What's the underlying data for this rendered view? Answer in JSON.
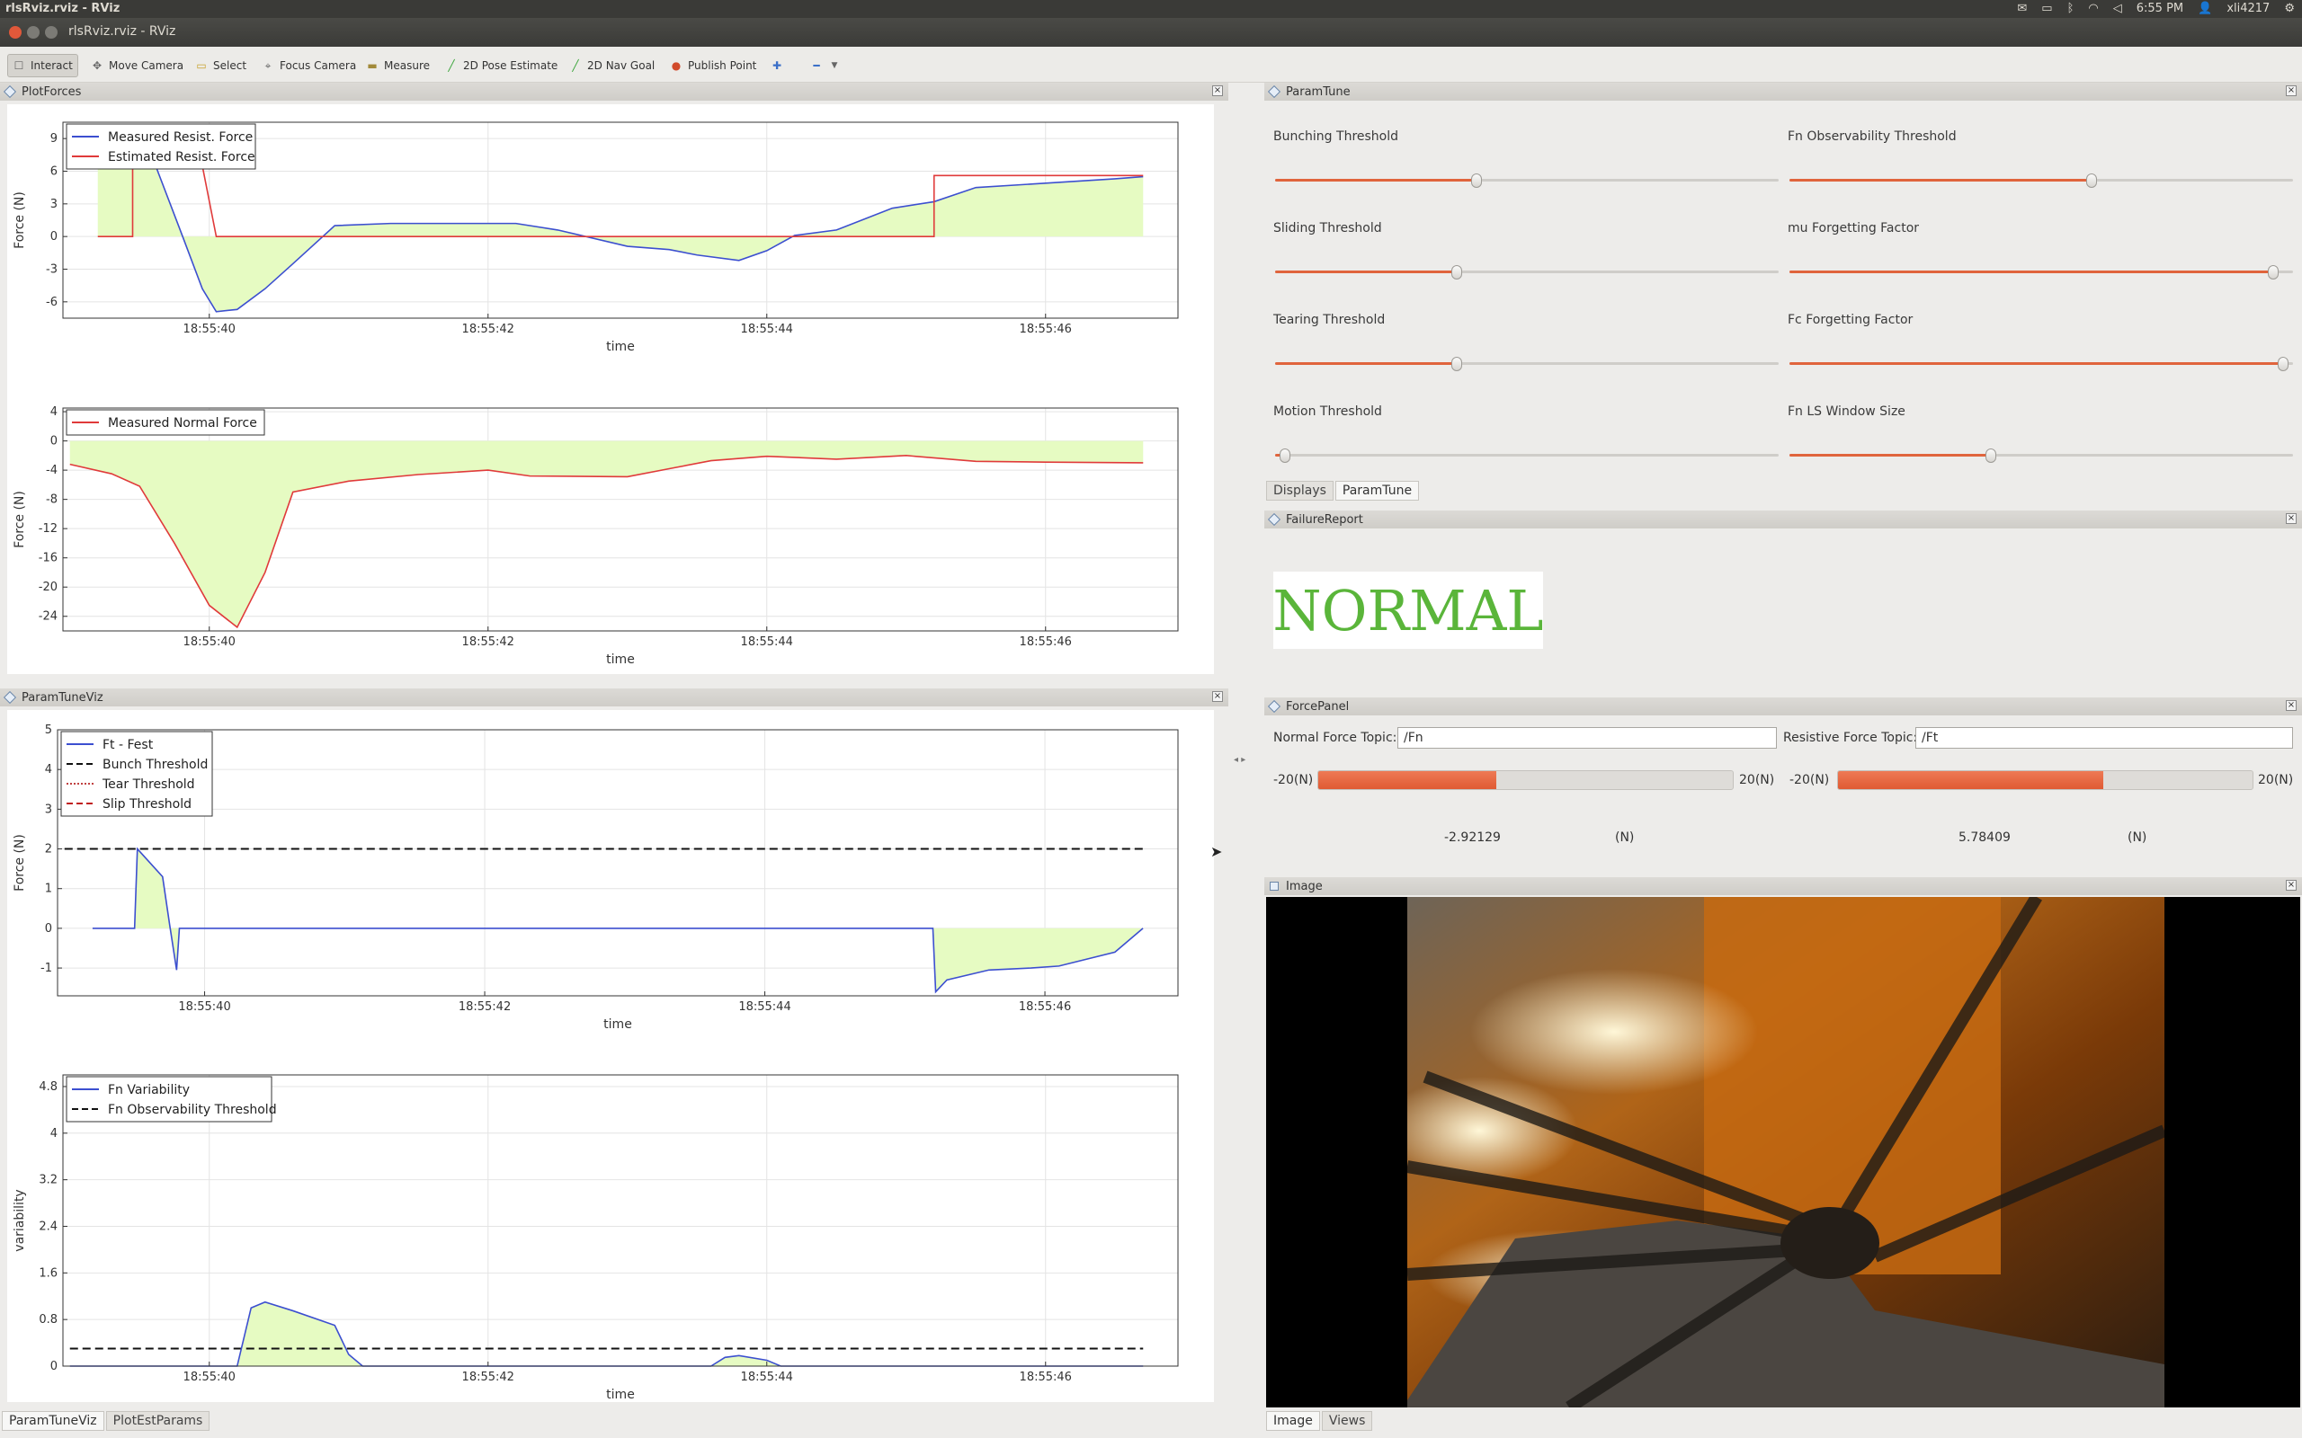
{
  "system": {
    "window_title": "rlsRviz.rviz - RViz",
    "time": "6:55 PM",
    "user": "xli4217"
  },
  "window": {
    "title": "rlsRviz.rviz - RViz"
  },
  "toolbar": {
    "items": [
      "Interact",
      "Move Camera",
      "Select",
      "Focus Camera",
      "Measure",
      "2D Pose Estimate",
      "2D Nav Goal",
      "Publish Point"
    ]
  },
  "panels": {
    "plotforces": {
      "title": "PlotForces"
    },
    "paramtuneviz": {
      "title": "ParamTuneViz"
    },
    "paramtune": {
      "title": "ParamTune",
      "sliders": [
        {
          "label": "Bunching Threshold",
          "value": 0.4
        },
        {
          "label": "Fn Observability Threshold",
          "value": 0.6
        },
        {
          "label": "Sliding Threshold",
          "value": 0.36
        },
        {
          "label": "mu Forgetting Factor",
          "value": 0.96
        },
        {
          "label": "Tearing Threshold",
          "value": 0.36
        },
        {
          "label": "Fc Forgetting Factor",
          "value": 0.98
        },
        {
          "label": "Motion Threshold",
          "value": 0.02
        },
        {
          "label": "Fn LS Window Size",
          "value": 0.4
        }
      ]
    },
    "failurereport": {
      "title": "FailureReport",
      "status": "NORMAL",
      "status_color": "#5ab53a"
    },
    "forcepanel": {
      "title": "ForcePanel",
      "normal_label": "Normal Force Topic:",
      "normal_topic": "/Fn",
      "resistive_label": "Resistive Force Topic:",
      "resistive_topic": "/Ft",
      "min": "-20(N)",
      "max": "20(N)",
      "normal_value": "-2.92129",
      "resistive_value": "5.78409",
      "unit": "(N)",
      "normal_fill": 0.43,
      "resistive_fill": 0.64
    },
    "image": {
      "title": "Image"
    }
  },
  "tabs": {
    "right_top": [
      "Displays",
      "ParamTune"
    ],
    "left_bottom": [
      "ParamTuneViz",
      "PlotEstParams"
    ],
    "right_bottom": [
      "Image",
      "Views"
    ]
  },
  "chart_data": [
    {
      "type": "line",
      "legend": [
        "Measured Resist. Force",
        "Estimated Resist. Force"
      ],
      "ylabel": "Force (N)",
      "xlabel": "time",
      "yticks": [
        9,
        6,
        3,
        0,
        -3,
        -6
      ],
      "xticks": [
        "18:55:40",
        "18:55:42",
        "18:55:44",
        "18:55:46"
      ],
      "ylim": [
        -7.5,
        10.5
      ],
      "xlim": [
        38.95,
        46.95
      ],
      "series": [
        {
          "name": "Measured Resist. Force",
          "color": "#3c4fd0",
          "x": [
            39.2,
            39.5,
            39.6,
            39.8,
            39.95,
            40.05,
            40.2,
            40.4,
            40.6,
            40.9,
            41.3,
            41.8,
            42.2,
            42.5,
            43.0,
            43.3,
            43.5,
            43.8,
            44.0,
            44.2,
            44.5,
            44.9,
            45.2,
            45.5,
            46.0,
            46.5,
            46.7
          ],
          "y": [
            6.5,
            6.5,
            7.0,
            0.3,
            -4.8,
            -6.9,
            -6.7,
            -4.8,
            -2.5,
            1.0,
            1.2,
            1.2,
            1.2,
            0.6,
            -0.9,
            -1.2,
            -1.7,
            -2.2,
            -1.3,
            0.1,
            0.6,
            2.6,
            3.2,
            4.5,
            4.9,
            5.3,
            5.5
          ]
        },
        {
          "name": "Estimated Resist. Force",
          "color": "#e03a3a",
          "x": [
            39.2,
            39.45,
            39.45,
            39.95,
            40.05,
            45.2,
            45.2,
            46.7
          ],
          "y": [
            0,
            0,
            6.5,
            6.5,
            0,
            0,
            5.6,
            5.6
          ]
        }
      ]
    },
    {
      "type": "line",
      "legend": [
        "Measured Normal Force"
      ],
      "ylabel": "Force (N)",
      "xlabel": "time",
      "yticks": [
        4,
        0,
        -4,
        -8,
        -12,
        -16,
        -20,
        -24
      ],
      "xticks": [
        "18:55:40",
        "18:55:42",
        "18:55:44",
        "18:55:46"
      ],
      "ylim": [
        -26,
        4.5
      ],
      "xlim": [
        38.95,
        46.95
      ],
      "series": [
        {
          "name": "Measured Normal Force",
          "color": "#e03a3a",
          "x": [
            39.0,
            39.3,
            39.5,
            39.75,
            40.0,
            40.2,
            40.4,
            40.6,
            41.0,
            41.5,
            42.0,
            42.3,
            43.0,
            43.3,
            43.6,
            44.0,
            44.5,
            45.0,
            45.5,
            46.0,
            46.7
          ],
          "y": [
            -3.2,
            -4.5,
            -6.2,
            -14.0,
            -22.5,
            -25.5,
            -18.0,
            -7.0,
            -5.5,
            -4.6,
            -4.0,
            -4.8,
            -4.9,
            -3.8,
            -2.7,
            -2.1,
            -2.5,
            -2.0,
            -2.8,
            -2.9,
            -3.0
          ]
        }
      ]
    },
    {
      "type": "line",
      "legend": [
        "Ft - Fest",
        "Bunch Threshold",
        "Tear Threshold",
        "Slip Threshold"
      ],
      "ylabel": "Force (N)",
      "xlabel": "time",
      "yticks": [
        5,
        4,
        3,
        2,
        1,
        0,
        -1
      ],
      "xticks": [
        "18:55:40",
        "18:55:42",
        "18:55:44",
        "18:55:46"
      ],
      "ylim": [
        -1.7,
        5.0
      ],
      "xlim": [
        38.95,
        46.95
      ],
      "thresholds": [
        {
          "name": "Bunch Threshold",
          "value": 2.0
        }
      ],
      "series": [
        {
          "name": "Ft - Fest",
          "color": "#3c4fd0",
          "x": [
            39.2,
            39.5,
            39.52,
            39.7,
            39.75,
            39.8,
            39.82,
            45.2,
            45.22,
            45.3,
            45.6,
            45.9,
            46.1,
            46.5,
            46.7
          ],
          "y": [
            0,
            0,
            2.0,
            1.3,
            0.1,
            -1.05,
            0,
            0,
            -1.6,
            -1.3,
            -1.05,
            -1.0,
            -0.95,
            -0.6,
            0
          ]
        }
      ]
    },
    {
      "type": "line",
      "legend": [
        "Fn Variability",
        "Fn Observability Threshold"
      ],
      "ylabel": "variability",
      "xlabel": "time",
      "yticks": [
        4.8,
        4,
        3.2,
        2.4,
        1.6,
        0.8,
        0
      ],
      "xticks": [
        "18:55:40",
        "18:55:42",
        "18:55:44",
        "18:55:46"
      ],
      "ylim": [
        0,
        5.0
      ],
      "xlim": [
        38.95,
        46.95
      ],
      "thresholds": [
        {
          "name": "Fn Observability Threshold",
          "value": 0.3
        }
      ],
      "series": [
        {
          "name": "Fn Variability",
          "color": "#3c4fd0",
          "x": [
            39.0,
            40.2,
            40.3,
            40.4,
            40.6,
            40.9,
            41.0,
            41.1,
            43.6,
            43.7,
            43.8,
            44.0,
            44.1,
            46.7
          ],
          "y": [
            0,
            0,
            1.0,
            1.1,
            0.95,
            0.7,
            0.2,
            0,
            0,
            0.15,
            0.18,
            0.1,
            0,
            0
          ]
        }
      ]
    }
  ]
}
